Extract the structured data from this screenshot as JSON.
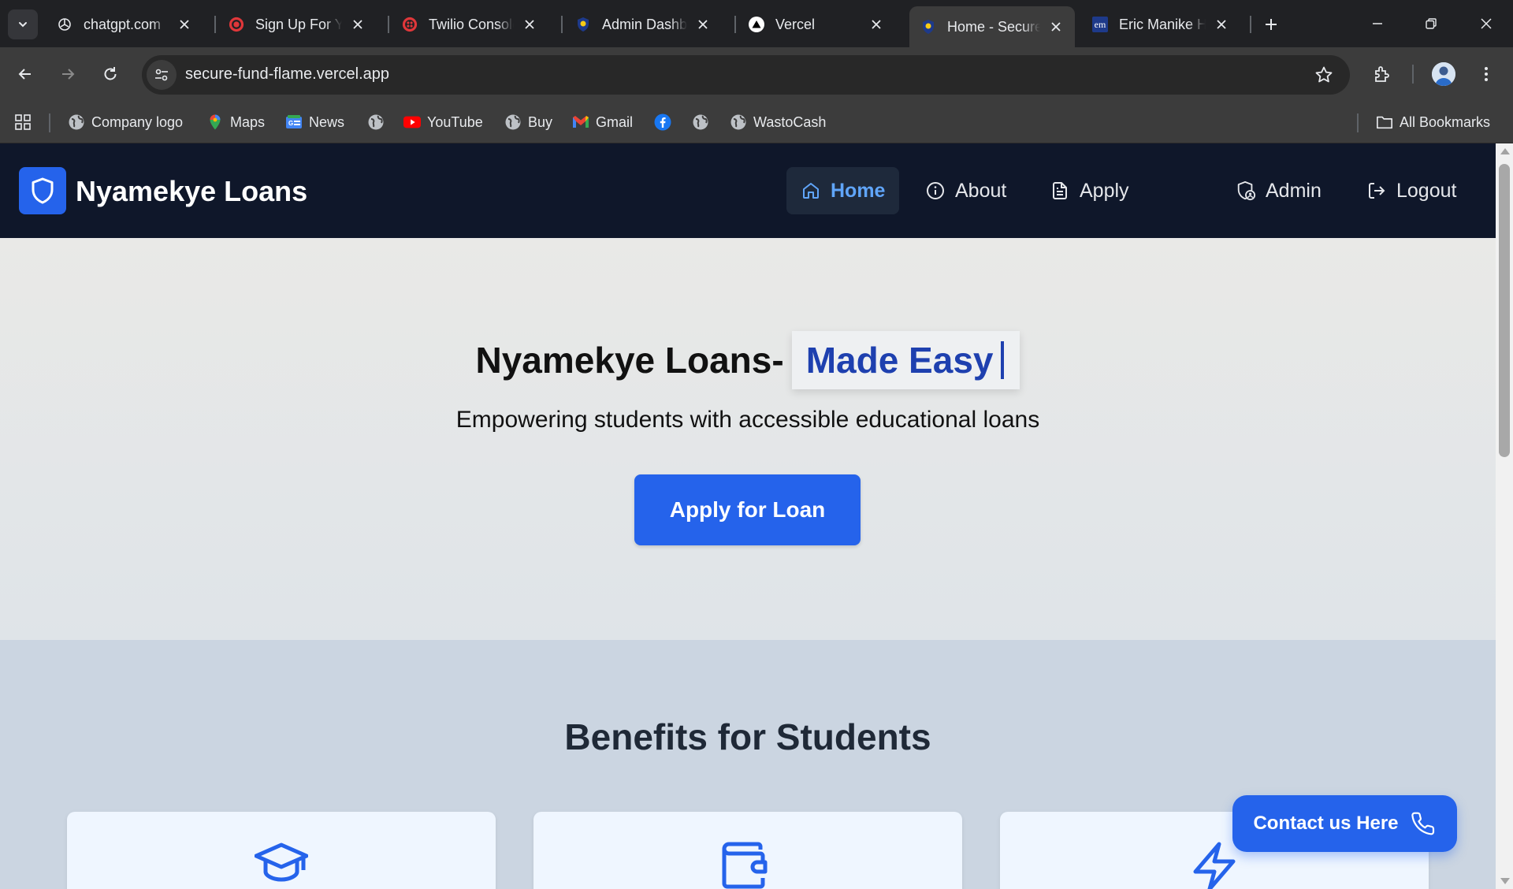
{
  "browser": {
    "tabs": [
      {
        "title": "chatgpt.com",
        "icon": "openai-icon",
        "active": false
      },
      {
        "title": "Sign Up For Your",
        "icon": "target-icon",
        "active": false
      },
      {
        "title": "Twilio Console",
        "icon": "twilio-icon",
        "active": false
      },
      {
        "title": "Admin Dashboard",
        "icon": "shield-favicon-icon",
        "active": false
      },
      {
        "title": "Vercel",
        "icon": "vercel-icon",
        "active": false
      },
      {
        "title": "Home - Secure",
        "icon": "shield-favicon-icon",
        "active": true
      },
      {
        "title": "Eric Manike Hub",
        "icon": "em-icon",
        "active": false,
        "favicon_text": "em"
      }
    ],
    "url": "secure-fund-flame.vercel.app",
    "bookmarks": [
      {
        "label": "Company logo",
        "icon": "globe-icon"
      },
      {
        "label": "Maps",
        "icon": "maps-icon"
      },
      {
        "label": "News",
        "icon": "news-icon"
      },
      {
        "label": "",
        "icon": "globe-icon"
      },
      {
        "label": "YouTube",
        "icon": "youtube-icon"
      },
      {
        "label": "Buy",
        "icon": "globe-icon"
      },
      {
        "label": "Gmail",
        "icon": "gmail-icon"
      },
      {
        "label": "",
        "icon": "facebook-icon"
      },
      {
        "label": "",
        "icon": "globe-icon"
      },
      {
        "label": "WastoCash",
        "icon": "globe-icon"
      }
    ],
    "all_bookmarks_label": "All Bookmarks"
  },
  "site": {
    "brand": "Nyamekye Loans",
    "nav": [
      {
        "label": "Home",
        "icon": "home-icon",
        "active": true
      },
      {
        "label": "About",
        "icon": "info-icon",
        "active": false
      },
      {
        "label": "Apply",
        "icon": "file-text-icon",
        "active": false
      }
    ],
    "admin_label": "Admin",
    "logout_label": "Logout"
  },
  "hero": {
    "title": "Nyamekye Loans-",
    "typed": "Made Easy",
    "subtitle": "Empowering students with accessible educational loans",
    "cta": "Apply for Loan"
  },
  "benefits": {
    "title": "Benefits for Students",
    "cards": [
      {
        "icon": "graduation-cap-icon"
      },
      {
        "icon": "wallet-icon"
      },
      {
        "icon": "zap-icon"
      }
    ]
  },
  "contact": {
    "label": "Contact us Here",
    "icon": "phone-icon"
  },
  "colors": {
    "brand_blue": "#2563eb",
    "nav_bg": "#0f172a",
    "active_nav_text": "#60a5fa",
    "typed_text": "#1e40af",
    "benefits_bg": "#cbd5e1",
    "card_bg": "#eff6ff"
  }
}
